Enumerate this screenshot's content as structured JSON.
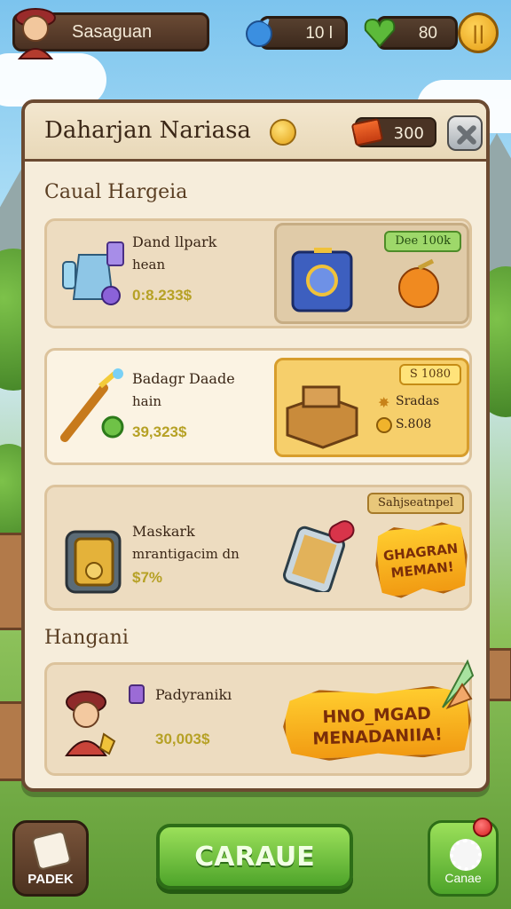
{
  "hud": {
    "player_name": "Sasaguan",
    "gems": "10 l",
    "hearts": "80"
  },
  "panel": {
    "title": "Daharjan Nariasa",
    "header_value": "300"
  },
  "sections": {
    "first": "Caual Hargeia",
    "second": "Hangani"
  },
  "cards": [
    {
      "title": "Dand llpark",
      "subtitle": "hean",
      "price": "0:8.233$",
      "tag": "Dee 100k"
    },
    {
      "title": "Badagr Daade",
      "subtitle": "hain",
      "price": "39,323$",
      "tag": "S 1080",
      "rewards": [
        "Sradas",
        "S.808"
      ]
    },
    {
      "title": "Maskark",
      "subtitle": "mrantigacim dn",
      "price": "$7%",
      "tag": "Sahjseatnpel",
      "banner": "GHAGRAN\nMEMAN!"
    },
    {
      "title": "Padyranikı",
      "price": "30,003$",
      "banner": "HNO_MGAD\nMENADANIIA!"
    }
  ],
  "buttons": {
    "left": "PADEK",
    "main": "CARAUE",
    "right": "Canae"
  }
}
